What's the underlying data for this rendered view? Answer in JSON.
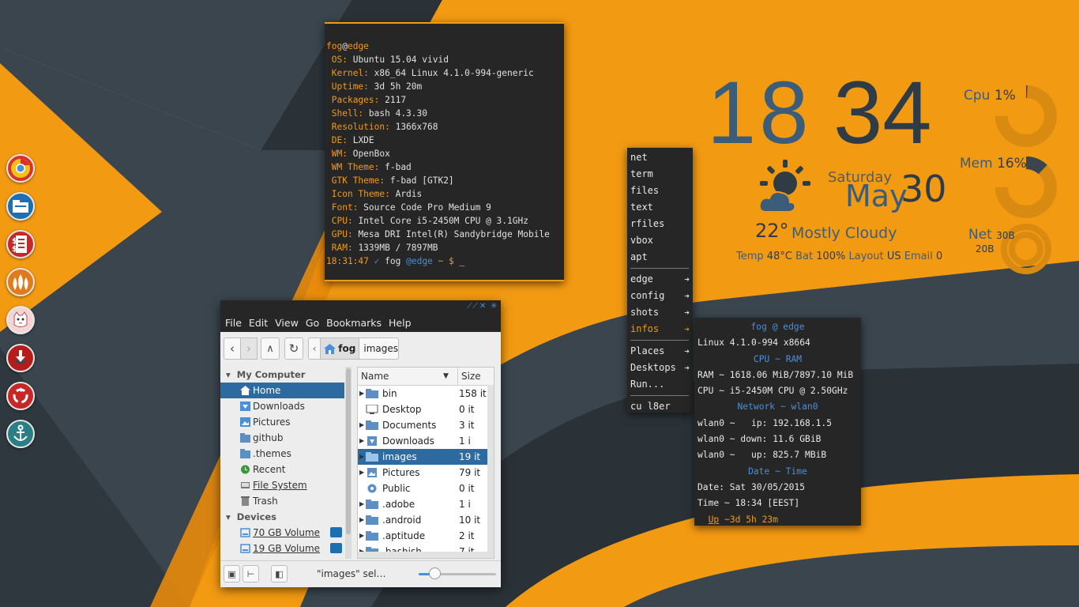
{
  "colors": {
    "accent": "#f29a12",
    "dark": "#262626",
    "blue": "#4a8fd8",
    "slate": "#2f3b45"
  },
  "dock": [
    {
      "name": "chromium-icon",
      "color": "#d9322b"
    },
    {
      "name": "file-manager-icon",
      "color": "#1f6fb0"
    },
    {
      "name": "spreadsheet-icon",
      "color": "#c62828"
    },
    {
      "name": "flames-icon",
      "color": "#e07a1a"
    },
    {
      "name": "cat-icon",
      "color": "#e06b6b"
    },
    {
      "name": "download-icon",
      "color": "#b71c1c"
    },
    {
      "name": "recycle-icon",
      "color": "#c62828"
    },
    {
      "name": "anchor-icon",
      "color": "#2a7f86"
    }
  ],
  "terminal": {
    "user": "fog",
    "at": "@",
    "host": "edge",
    "lines": [
      {
        "key": "OS:",
        "val": " Ubuntu 15.04 vivid"
      },
      {
        "key": "Kernel:",
        "val": " x86_64 Linux 4.1.0-994-generic"
      },
      {
        "key": "Uptime:",
        "val": " 3d 5h 20m"
      },
      {
        "key": "Packages:",
        "val": " 2117"
      },
      {
        "key": "Shell:",
        "val": " bash 4.3.30"
      },
      {
        "key": "Resolution:",
        "val": " 1366x768"
      },
      {
        "key": "DE:",
        "val": " LXDE"
      },
      {
        "key": "WM:",
        "val": " OpenBox"
      },
      {
        "key": "WM Theme:",
        "val": " f-bad"
      },
      {
        "key": "GTK Theme:",
        "val": " f-bad [GTK2]"
      },
      {
        "key": "Icon Theme:",
        "val": " Ardis"
      },
      {
        "key": "Font:",
        "val": " Source Code Pro Medium 9"
      },
      {
        "key": "CPU:",
        "val": " Intel Core i5-2450M CPU @ 3.1GHz"
      },
      {
        "key": "GPU:",
        "val": " Mesa DRI Intel(R) Sandybridge Mobile"
      },
      {
        "key": "RAM:",
        "val": " 1339MB / 7897MB"
      }
    ],
    "prompt_time": "18:31:47",
    "prompt_check": "✓",
    "prompt_user": "fog",
    "prompt_host": "@edge",
    "prompt_path": "~ $",
    "cursor": "_"
  },
  "clock": {
    "hours": "18",
    "minutes": "34"
  },
  "date": {
    "day": "Saturday",
    "month": "May",
    "num": "30"
  },
  "weather": {
    "temp": "22°",
    "desc": "Mostly Cloudy"
  },
  "info": {
    "temp_label": "Temp",
    "temp": "48°C",
    "bat_label": "Bat",
    "bat": "100%",
    "layout_label": "Layout",
    "layout": "US",
    "email_label": "Email",
    "email": "0"
  },
  "gauges": {
    "cpu": {
      "label": "Cpu",
      "pct": "1%",
      "value": 0.01
    },
    "mem": {
      "label": "Mem",
      "pct": "16%",
      "value": 0.16
    },
    "net": {
      "label": "Net",
      "up": "30B",
      "down": "20B"
    }
  },
  "menu": {
    "items1": [
      "net",
      "term",
      "files",
      "text",
      "rfiles",
      "vbox",
      "apt"
    ],
    "items2": [
      "edge",
      "config",
      "shots",
      "infos"
    ],
    "items3": [
      "Places",
      "Desktops",
      "Run..."
    ],
    "last": "cu l8er",
    "arrow": "➔"
  },
  "sysinfo": {
    "title": "fog @ edge",
    "kernel": "Linux 4.1.0-994 x8664",
    "cpu_ram": "CPU ~ RAM",
    "ram": "RAM ~ 1618.06 MiB/7897.10 MiB",
    "cpu": "CPU ~ i5-2450M CPU @ 2.50GHz",
    "network": "Network ~ wlan0",
    "ip": "wlan0 ~   ip: 192.168.1.5",
    "down": "wlan0 ~ down: 11.6 GBiB",
    "up": "wlan0 ~   up: 825.7 MBiB",
    "datetime": "Date ~ Time",
    "date": "Date: Sat 30/05/2015",
    "time": "Time ~ 18:34 [EEST]",
    "uptime_label": "Up",
    "uptime": " ~3d 5h 23m"
  },
  "filemanager": {
    "menubar": [
      "File",
      "Edit",
      "View",
      "Go",
      "Bookmarks",
      "Help"
    ],
    "breadcrumb": [
      "fog",
      "images"
    ],
    "sidebar_header": "My Computer",
    "sidebar": [
      "Home",
      "Downloads",
      "Pictures",
      "github",
      ".themes",
      "Recent",
      "File System",
      "Trash"
    ],
    "devices_header": "Devices",
    "devices": [
      "70 GB Volume",
      "19 GB Volume"
    ],
    "columns": {
      "name": "Name",
      "size": "Size"
    },
    "files": [
      {
        "name": "bin",
        "size": "158 it"
      },
      {
        "name": "Desktop",
        "size": "0 it"
      },
      {
        "name": "Documents",
        "size": "3 it"
      },
      {
        "name": "Downloads",
        "size": "1 i"
      },
      {
        "name": "images",
        "size": "19 it"
      },
      {
        "name": "Pictures",
        "size": "79 it"
      },
      {
        "name": "Public",
        "size": "0 it"
      },
      {
        "name": ".adobe",
        "size": "1 i"
      },
      {
        "name": ".android",
        "size": "10 it"
      },
      {
        "name": ".aptitude",
        "size": "2 it"
      },
      {
        "name": ".bashish",
        "size": "7 it"
      }
    ],
    "status": "\"images\" sel…",
    "zoom": 0.2
  }
}
